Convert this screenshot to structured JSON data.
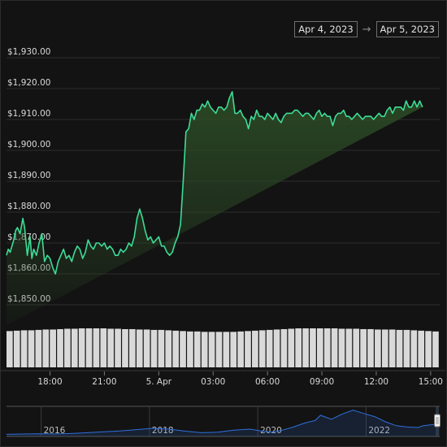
{
  "range_selector": {
    "from": "Apr 4, 2023",
    "arrow": "→",
    "to": "Apr 5, 2023"
  },
  "colors": {
    "line": "#3ddc97",
    "fill_top": "#2b4a25",
    "volume": "#d9d9d9",
    "grid": "#2e2e2e",
    "navigator_line": "#2f6fdc"
  },
  "chart_data": [
    {
      "type": "area",
      "name": "price",
      "ylim": [
        1845,
        1935
      ],
      "yticks": [
        1850,
        1860,
        1870,
        1880,
        1890,
        1900,
        1910,
        1920,
        1930
      ],
      "ytick_labels": [
        "$1,850.00",
        "$1,860.00",
        "$1,870.00",
        "$1,880.00",
        "$1,890.00",
        "$1,900.00",
        "$1,910.00",
        "$1,920.00",
        "$1,930.00"
      ],
      "x_hours": [
        15.6,
        15.7,
        15.8,
        15.9,
        16.0,
        16.1,
        16.2,
        16.35,
        16.5,
        16.6,
        16.75,
        16.9,
        17.0,
        17.1,
        17.25,
        17.4,
        17.55,
        17.7,
        17.85,
        18.0,
        18.15,
        18.3,
        18.45,
        18.6,
        18.75,
        18.9,
        19.05,
        19.2,
        19.35,
        19.5,
        19.65,
        19.8,
        19.95,
        20.1,
        20.25,
        20.4,
        20.55,
        20.7,
        20.85,
        21.0,
        21.15,
        21.3,
        21.45,
        21.6,
        21.75,
        21.9,
        22.05,
        22.2,
        22.35,
        22.5,
        22.65,
        22.8,
        22.95,
        23.1,
        23.25,
        23.4,
        23.55,
        23.7,
        23.85,
        24.0,
        24.15,
        24.3,
        24.45,
        24.6,
        24.75,
        24.9,
        25.05,
        25.2,
        25.35,
        25.5,
        25.65,
        25.8,
        25.95,
        26.1,
        26.25,
        26.4,
        26.55,
        26.7,
        26.85,
        27.0,
        27.15,
        27.3,
        27.45,
        27.6,
        27.75,
        27.9,
        28.05,
        28.2,
        28.35,
        28.5,
        28.65,
        28.8,
        28.95,
        29.1,
        29.25,
        29.4,
        29.55,
        29.7,
        29.85,
        30.0,
        30.15,
        30.3,
        30.45,
        30.6,
        30.75,
        30.9,
        31.05,
        31.2,
        31.35,
        31.5,
        31.65,
        31.8,
        31.95,
        32.1,
        32.25,
        32.4,
        32.55,
        32.7,
        32.85,
        33.0,
        33.15,
        33.3,
        33.45,
        33.6,
        33.75,
        33.9,
        34.05,
        34.2,
        34.35,
        34.5,
        34.65,
        34.8,
        34.95,
        35.1,
        35.25,
        35.4,
        35.55,
        35.7,
        35.85,
        36.0,
        36.15,
        36.3,
        36.45,
        36.6,
        36.75,
        36.9,
        37.05,
        37.2,
        37.35,
        37.5,
        37.65,
        37.8,
        37.95,
        38.1,
        38.25,
        38.4,
        38.55,
        38.7,
        38.85,
        39.0,
        39.15,
        39.3,
        39.5
      ],
      "y": [
        1866,
        1868,
        1867,
        1869,
        1871,
        1874,
        1875,
        1873,
        1878,
        1875,
        1866,
        1872,
        1865,
        1868,
        1866,
        1870,
        1873,
        1864,
        1866,
        1865,
        1862,
        1860,
        1864,
        1866,
        1868,
        1865,
        1866,
        1864,
        1867,
        1869,
        1868,
        1865,
        1867,
        1871,
        1869,
        1868,
        1870,
        1870,
        1869,
        1870,
        1868,
        1869,
        1868,
        1866,
        1866,
        1868,
        1867,
        1868,
        1870,
        1869,
        1872,
        1878,
        1881,
        1878,
        1874,
        1871,
        1872,
        1870,
        1871,
        1872,
        1869,
        1869,
        1867,
        1866,
        1867,
        1870,
        1872,
        1876,
        1890,
        1906,
        1907,
        1912,
        1910,
        1913,
        1913,
        1915,
        1914,
        1916,
        1914,
        1913,
        1912,
        1914,
        1914,
        1913,
        1914,
        1917,
        1919,
        1912,
        1912,
        1913,
        1911,
        1910,
        1907,
        1911,
        1910,
        1913,
        1911,
        1911,
        1910,
        1912,
        1911,
        1910,
        1912,
        1910,
        1909,
        1911,
        1912,
        1912,
        1912,
        1913,
        1913,
        1912,
        1911,
        1912,
        1912,
        1911,
        1910,
        1912,
        1913,
        1911,
        1912,
        1911,
        1911,
        1908,
        1911,
        1912,
        1912,
        1913,
        1911,
        1911,
        1910,
        1911,
        1912,
        1911,
        1910,
        1911,
        1911,
        1911,
        1910,
        1911,
        1912,
        1911,
        1911,
        1913,
        1914,
        1912,
        1914,
        1914,
        1914,
        1913,
        1916,
        1914,
        1914,
        1916,
        1914,
        1916,
        1914
      ],
      "x_ticks_hours": [
        18,
        21,
        24,
        27,
        30,
        33,
        36,
        39
      ],
      "x_tick_labels": [
        "18:00",
        "21:00",
        "5. Apr",
        "03:00",
        "06:00",
        "09:00",
        "12:00",
        "15:00"
      ]
    },
    {
      "type": "bar",
      "name": "volume",
      "ylim": [
        0,
        1
      ],
      "values": [
        0.93,
        0.94,
        0.95,
        0.95,
        0.96,
        0.97,
        0.97,
        0.98,
        0.99,
        0.99,
        1.0,
        1.0,
        1.0,
        1.0,
        0.99,
        0.99,
        0.98,
        0.98,
        0.97,
        0.97,
        0.96,
        0.96,
        0.95,
        0.94,
        0.93,
        0.92,
        0.92,
        0.91,
        0.91,
        0.91,
        0.91,
        0.91,
        0.92,
        0.93,
        0.94,
        0.95,
        0.96,
        0.97,
        0.98,
        0.99,
        1.0,
        1.0,
        1.0,
        1.0,
        1.0,
        1.0,
        0.99,
        0.99,
        0.99,
        0.98,
        0.98,
        0.97,
        0.97,
        0.97,
        0.96,
        0.96,
        0.95,
        0.94,
        0.93,
        0.92
      ]
    },
    {
      "type": "line",
      "name": "navigator",
      "x_years": [
        2015.3,
        2015.6,
        2015.9,
        2016.2,
        2016.5,
        2016.8,
        2017.1,
        2017.4,
        2017.7,
        2018.0,
        2018.3,
        2018.6,
        2018.9,
        2019.2,
        2019.5,
        2019.8,
        2020.0,
        2020.2,
        2020.4,
        2020.6,
        2020.8,
        2021.0,
        2021.1,
        2021.3,
        2021.5,
        2021.7,
        2021.9,
        2022.1,
        2022.3,
        2022.5,
        2022.7,
        2022.9,
        2023.0,
        2023.2,
        2023.3
      ],
      "y": [
        0.02,
        0.03,
        0.04,
        0.03,
        0.05,
        0.08,
        0.12,
        0.15,
        0.2,
        0.25,
        0.22,
        0.14,
        0.08,
        0.1,
        0.18,
        0.22,
        0.15,
        0.1,
        0.18,
        0.3,
        0.45,
        0.55,
        0.75,
        0.6,
        0.8,
        0.95,
        0.82,
        0.7,
        0.5,
        0.35,
        0.3,
        0.28,
        0.35,
        0.4,
        0.42
      ],
      "x_tick_labels": [
        "2016",
        "2018",
        "2020",
        "2022"
      ],
      "x_ticks_years": [
        2016,
        2018,
        2020,
        2022
      ]
    }
  ]
}
